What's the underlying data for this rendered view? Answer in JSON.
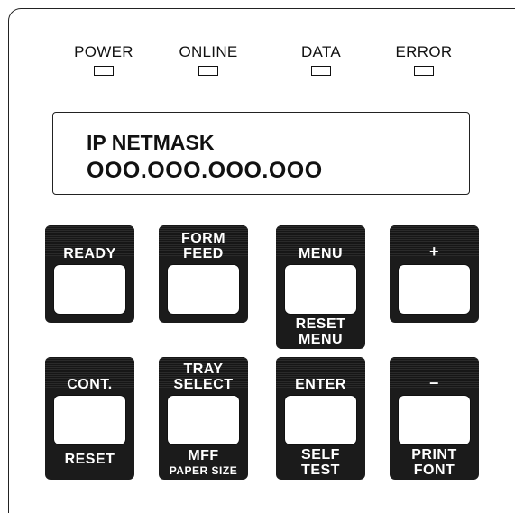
{
  "leds": [
    {
      "label": "POWER"
    },
    {
      "label": "ONLINE"
    },
    {
      "label": "DATA"
    },
    {
      "label": "ERROR"
    }
  ],
  "display": {
    "line1": "IP NETMASK",
    "line2": "OOO.OOO.OOO.OOO"
  },
  "keys": {
    "ready": {
      "top": "READY"
    },
    "form_feed": {
      "top_line1": "FORM",
      "top_line2": "FEED"
    },
    "menu": {
      "top": "MENU",
      "bottom_line1": "RESET",
      "bottom_line2": "MENU"
    },
    "plus": {
      "top": "+"
    },
    "cont": {
      "top": "CONT.",
      "bottom": "RESET"
    },
    "tray_select": {
      "top_line1": "TRAY",
      "top_line2": "SELECT",
      "bottom_line1": "MFF",
      "bottom_line2": "PAPER SIZE"
    },
    "enter": {
      "top": "ENTER",
      "bottom_line1": "SELF",
      "bottom_line2": "TEST"
    },
    "minus": {
      "top": "–",
      "bottom_line1": "PRINT",
      "bottom_line2": "FONT"
    }
  },
  "colors": {
    "key_body": "#1b1b1b",
    "panel_line": "#222222"
  }
}
